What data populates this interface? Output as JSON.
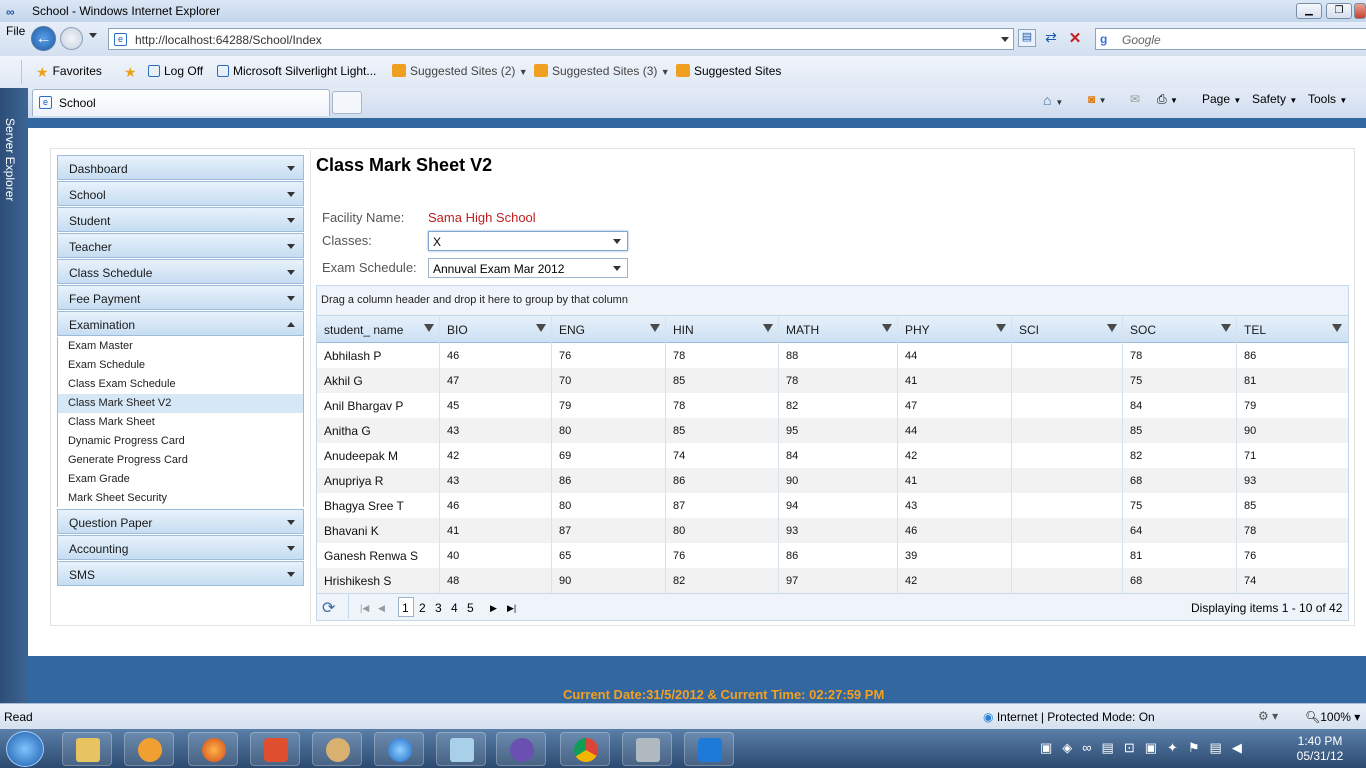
{
  "browser": {
    "window_title": "School - Windows Internet Explorer",
    "menu_file": "File",
    "url_prefix": "http://localhost",
    "url_rest": ":64288/School/Index",
    "search_placeholder": "Google",
    "tab_title": "School",
    "favorites": {
      "label": "Favorites",
      "items": [
        "Log Off",
        "Microsoft Silverlight Light...",
        "Suggested Sites (2)",
        "Suggested Sites (3)",
        "Suggested Sites"
      ]
    },
    "commands": [
      "Page",
      "Safety",
      "Tools"
    ],
    "side_panel": "Server Explorer"
  },
  "sidebar": {
    "menu": [
      {
        "label": "Dashboard"
      },
      {
        "label": "School"
      },
      {
        "label": "Student"
      },
      {
        "label": "Teacher"
      },
      {
        "label": "Class Schedule"
      },
      {
        "label": "Fee Payment"
      },
      {
        "label": "Examination"
      }
    ],
    "exam_items": [
      "Exam Master",
      "Exam Schedule",
      "Class Exam Schedule",
      "Class Mark Sheet V2",
      "Class Mark Sheet",
      "Dynamic Progress Card",
      "Generate Progress Card",
      "Exam Grade",
      "Mark Sheet Security"
    ],
    "selected_item": "Class Mark Sheet V2",
    "menu_after": [
      {
        "label": "Question Paper"
      },
      {
        "label": "Accounting"
      },
      {
        "label": "SMS"
      }
    ]
  },
  "main": {
    "title": "Class Mark Sheet V2",
    "facility_label": "Facility Name:",
    "facility_value": "Sama High School",
    "classes_label": "Classes:",
    "classes_value": "X",
    "exam_label": "Exam Schedule:",
    "exam_value": "Annuval Exam Mar 2012"
  },
  "grid": {
    "group_hint": "Drag a column header and drop it here to group by that column",
    "columns": [
      "student_ name",
      "BIO",
      "ENG",
      "HIN",
      "MATH",
      "PHY",
      "SCI",
      "SOC",
      "TEL"
    ],
    "rows": [
      [
        "Abhilash P",
        "46",
        "76",
        "78",
        "88",
        "44",
        "",
        "78",
        "86"
      ],
      [
        "Akhil G",
        "47",
        "70",
        "85",
        "78",
        "41",
        "",
        "75",
        "81"
      ],
      [
        "Anil Bhargav P",
        "45",
        "79",
        "78",
        "82",
        "47",
        "",
        "84",
        "79"
      ],
      [
        "Anitha G",
        "43",
        "80",
        "85",
        "95",
        "44",
        "",
        "85",
        "90"
      ],
      [
        "Anudeepak M",
        "42",
        "69",
        "74",
        "84",
        "42",
        "",
        "82",
        "71"
      ],
      [
        "Anupriya R",
        "43",
        "86",
        "86",
        "90",
        "41",
        "",
        "68",
        "93"
      ],
      [
        "Bhagya Sree T",
        "46",
        "80",
        "87",
        "94",
        "43",
        "",
        "75",
        "85"
      ],
      [
        "Bhavani K",
        "41",
        "87",
        "80",
        "93",
        "46",
        "",
        "64",
        "78"
      ],
      [
        "Ganesh Renwa S",
        "40",
        "65",
        "76",
        "86",
        "39",
        "",
        "81",
        "76"
      ],
      [
        "Hrishikesh S",
        "48",
        "90",
        "82",
        "97",
        "42",
        "",
        "68",
        "74"
      ]
    ],
    "pages": [
      "1",
      "2",
      "3",
      "4",
      "5"
    ],
    "current_page": "1",
    "display_text": "Displaying items 1 - 10 of 42"
  },
  "footer": {
    "text": "Current Date:31/5/2012 & Current Time: 02:27:59 PM"
  },
  "status": {
    "left": "Read",
    "zone": "Internet | Protected Mode: On",
    "zoom": "100%"
  },
  "taskbar": {
    "time": "1:40 PM",
    "date": "05/31/12"
  }
}
